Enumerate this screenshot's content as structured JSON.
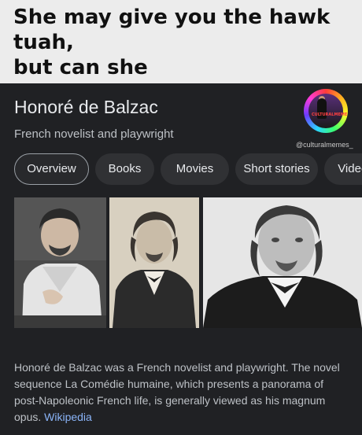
{
  "meme": {
    "caption_lines": [
      "She may give you the hawk",
      "tuah,",
      "but can she"
    ]
  },
  "knowledge_panel": {
    "title": "Honoré de Balzac",
    "subtitle": "French novelist and playwright",
    "watermark": "@culturalmemes_",
    "badge_text": "CULTURALMEMES",
    "chips": [
      {
        "label": "Overview",
        "active": true
      },
      {
        "label": "Books",
        "active": false
      },
      {
        "label": "Movies",
        "active": false
      },
      {
        "label": "Short stories",
        "active": false
      },
      {
        "label": "Videos",
        "active": false
      }
    ],
    "description": "Honoré de Balzac was a French novelist and playwright. The novel sequence La Comédie humaine, which presents a panorama of post-Napoleonic French life, is generally viewed as his magnum opus.",
    "source_link": "Wikipedia"
  }
}
